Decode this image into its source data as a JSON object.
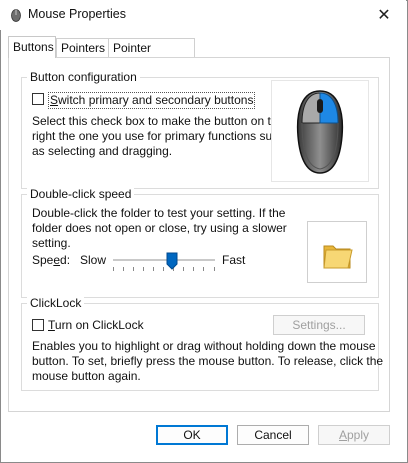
{
  "window": {
    "title": "Mouse Properties",
    "close_glyph": "✕"
  },
  "tabs": [
    {
      "label": "Buttons",
      "active": true
    },
    {
      "label": "Pointers",
      "active": false
    },
    {
      "label": "Pointer Options",
      "active": false
    }
  ],
  "button_configuration": {
    "legend": "Button configuration",
    "checkbox_label": "Switch primary and secondary buttons",
    "checked": false,
    "description_lines": [
      "Select this check box to make the button on the",
      "right the one you use for primary functions such",
      "as selecting and dragging."
    ],
    "image_icon": "mouse-icon"
  },
  "double_click": {
    "legend": "Double-click speed",
    "description_lines": [
      "Double-click the folder to test your setting. If the",
      "folder does not open or close, try using a slower",
      "setting."
    ],
    "speed_label": "Speed:",
    "slow_label": "Slow",
    "fast_label": "Fast",
    "speed_value": 0.58,
    "test_icon": "folder-icon"
  },
  "clicklock": {
    "legend": "ClickLock",
    "checkbox_label": "Turn on ClickLock",
    "checked": false,
    "settings_label": "Settings...",
    "description_lines": [
      "Enables you to highlight or drag without holding down the mouse",
      "button. To set, briefly press the mouse button. To release, click the",
      "mouse button again."
    ]
  },
  "footer": {
    "ok_label": "OK",
    "cancel_label": "Cancel",
    "apply_label": "Apply"
  },
  "colors": {
    "accent": "#0078d4",
    "mouse_highlight": "#1e88e5",
    "folder": "#f2c94c"
  }
}
